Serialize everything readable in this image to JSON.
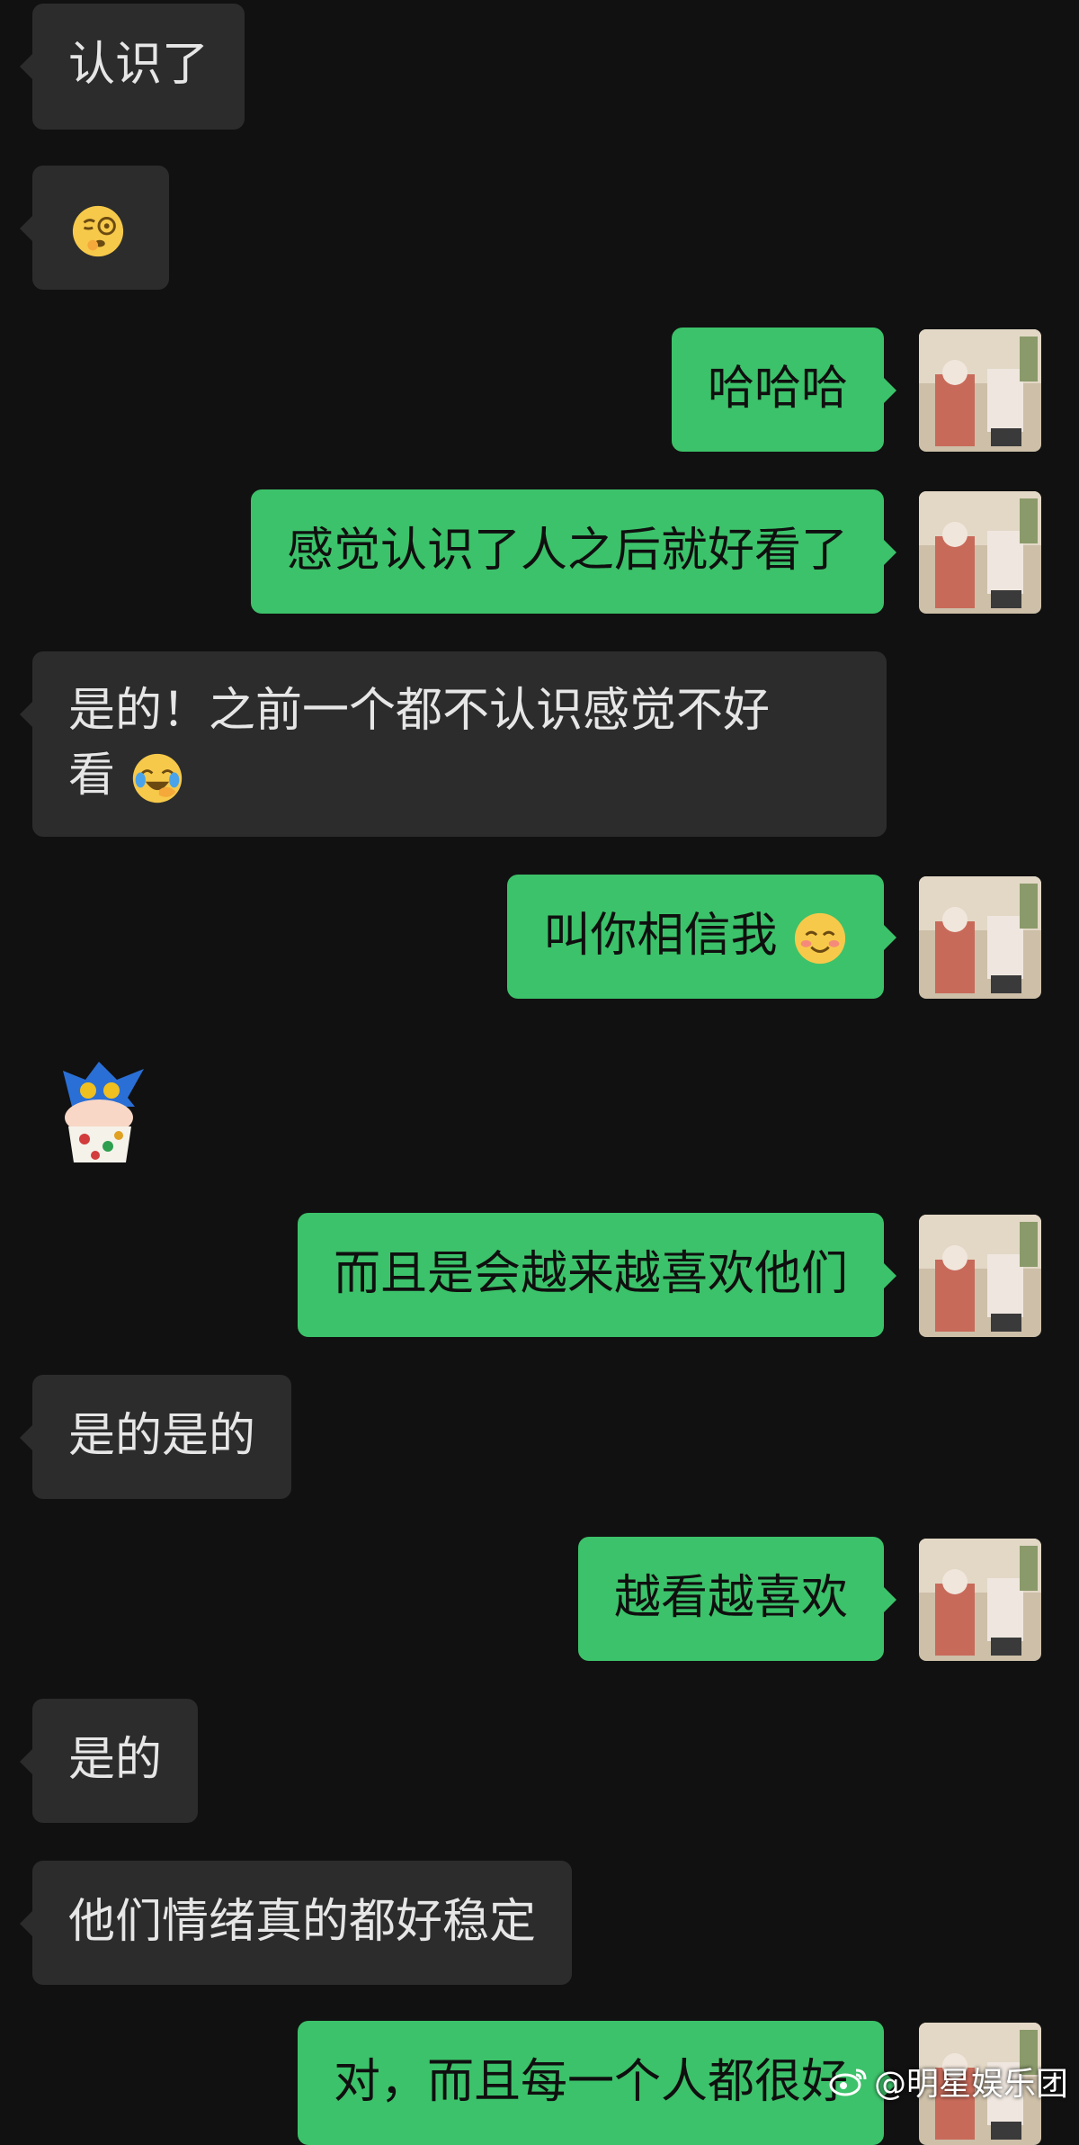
{
  "messages": {
    "m1": "认识了",
    "m3": "哈哈哈",
    "m4": "感觉认识了人之后就好看了",
    "m5_line1": "是的！之前一个都不认识感觉不好",
    "m5_line2": "看",
    "m6": "叫你相信我",
    "m8": "而且是会越来越喜欢他们",
    "m9": "是的是的",
    "m10": "越看越喜欢",
    "m11": "是的",
    "m12": "他们情绪真的都好稳定",
    "m13": "对，而且每一个人都很好"
  },
  "icons": {
    "thinking_emoji": "monocle-face-emoji",
    "laughing_emoji": "laughing-emoji",
    "smile_emoji": "smiling-face-emoji",
    "sticker": "cartoon-sticker",
    "watermark_logo": "weibo-logo"
  },
  "watermark": {
    "text": "@明星娱乐团"
  },
  "colors": {
    "background": "#111111",
    "incoming_bubble": "#2c2c2c",
    "outgoing_bubble": "#3cc26a"
  }
}
